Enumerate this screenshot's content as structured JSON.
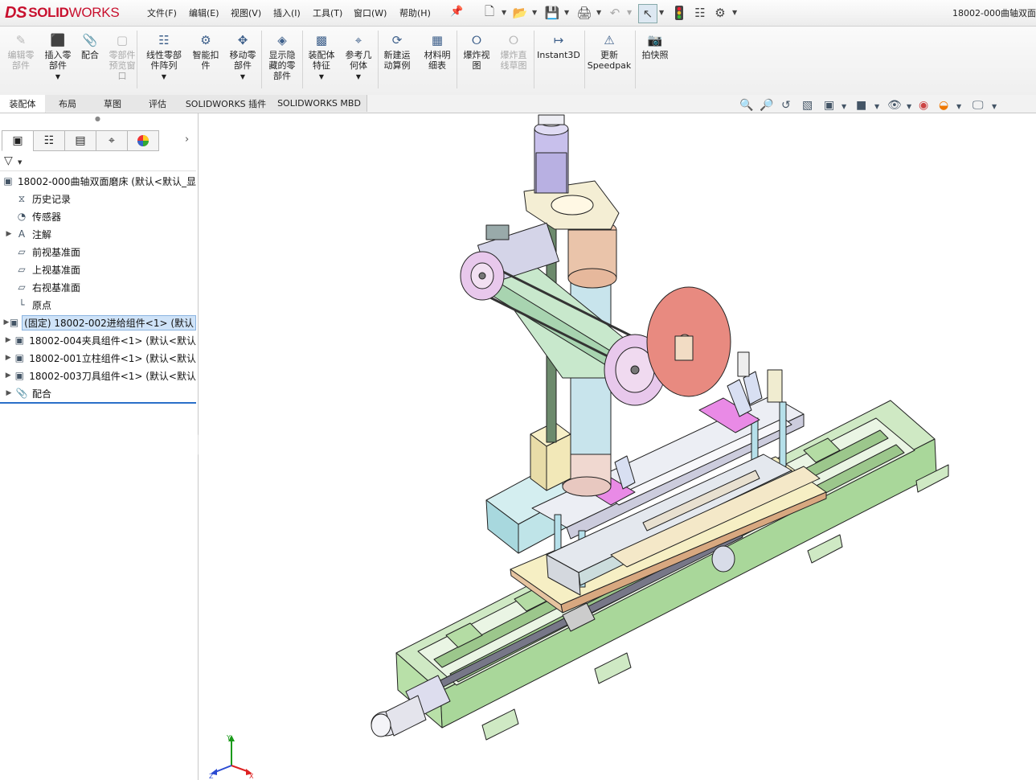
{
  "app": {
    "logo_ds": "DS",
    "logo_solid": "SOLID",
    "logo_works": "WORKS",
    "document_title": "18002-000曲轴双面"
  },
  "menu": [
    "文件(F)",
    "编辑(E)",
    "视图(V)",
    "插入(I)",
    "工具(T)",
    "窗口(W)",
    "帮助(H)"
  ],
  "commands": [
    {
      "label1": "编辑零",
      "label2": "部件",
      "label3": "",
      "disabled": true,
      "icon": "edit-component-icon"
    },
    {
      "label1": "插入零",
      "label2": "部件",
      "label3": "",
      "disabled": false,
      "icon": "insert-components-icon",
      "dropdown": true
    },
    {
      "label1": "配合",
      "label2": "",
      "label3": "",
      "disabled": false,
      "icon": "mate-icon"
    },
    {
      "label1": "零部件",
      "label2": "预览窗",
      "label3": "口",
      "disabled": true,
      "icon": "preview-window-icon"
    },
    {
      "label1": "线性零部",
      "label2": "件阵列",
      "label3": "",
      "disabled": false,
      "icon": "linear-pattern-icon",
      "dropdown": true
    },
    {
      "label1": "智能扣",
      "label2": "件",
      "label3": "",
      "disabled": false,
      "icon": "smart-fasteners-icon"
    },
    {
      "label1": "移动零",
      "label2": "部件",
      "label3": "",
      "disabled": false,
      "icon": "move-component-icon",
      "dropdown": true
    },
    {
      "label1": "显示隐",
      "label2": "藏的零",
      "label3": "部件",
      "disabled": false,
      "icon": "show-hidden-icon"
    },
    {
      "label1": "装配体",
      "label2": "特征",
      "label3": "",
      "disabled": false,
      "icon": "assembly-features-icon",
      "dropdown": true
    },
    {
      "label1": "参考几",
      "label2": "何体",
      "label3": "",
      "disabled": false,
      "icon": "reference-geometry-icon",
      "dropdown": true
    },
    {
      "label1": "新建运",
      "label2": "动算例",
      "label3": "",
      "disabled": false,
      "icon": "motion-study-icon"
    },
    {
      "label1": "材料明",
      "label2": "细表",
      "label3": "",
      "disabled": false,
      "icon": "bom-icon"
    },
    {
      "label1": "爆炸视",
      "label2": "图",
      "label3": "",
      "disabled": false,
      "icon": "exploded-view-icon"
    },
    {
      "label1": "爆炸直",
      "label2": "线草图",
      "label3": "",
      "disabled": true,
      "icon": "explode-line-icon"
    },
    {
      "label1": "Instant3D",
      "label2": "",
      "label3": "",
      "disabled": false,
      "icon": "instant3d-icon"
    },
    {
      "label1": "更新",
      "label2": "Speedpak",
      "label3": "",
      "disabled": false,
      "icon": "speedpak-icon"
    },
    {
      "label1": "拍快照",
      "label2": "",
      "label3": "",
      "disabled": false,
      "icon": "snapshot-icon"
    }
  ],
  "tabs": [
    "装配体",
    "布局",
    "草图",
    "评估",
    "SOLIDWORKS 插件",
    "SOLIDWORKS MBD"
  ],
  "tree": {
    "root": "18002-000曲轴双面磨床 (默认<默认_显",
    "items": [
      {
        "label": "历史记录",
        "expandable": false,
        "icon": "history-icon"
      },
      {
        "label": "传感器",
        "expandable": false,
        "icon": "sensor-icon"
      },
      {
        "label": "注解",
        "expandable": true,
        "icon": "annotation-icon"
      },
      {
        "label": "前视基准面",
        "expandable": false,
        "icon": "plane-icon"
      },
      {
        "label": "上视基准面",
        "expandable": false,
        "icon": "plane-icon"
      },
      {
        "label": "右视基准面",
        "expandable": false,
        "icon": "plane-icon"
      },
      {
        "label": "原点",
        "expandable": false,
        "icon": "origin-icon"
      },
      {
        "label": "(固定) 18002-002进给组件<1> (默认",
        "expandable": true,
        "icon": "subassembly-icon",
        "selected": true
      },
      {
        "label": "18002-004夹具组件<1> (默认<默认",
        "expandable": true,
        "icon": "subassembly-icon"
      },
      {
        "label": "18002-001立柱组件<1> (默认<默认",
        "expandable": true,
        "icon": "subassembly-icon"
      },
      {
        "label": "18002-003刀具组件<1> (默认<默认",
        "expandable": true,
        "icon": "subassembly-icon"
      },
      {
        "label": "配合",
        "expandable": true,
        "icon": "mates-folder-icon"
      }
    ]
  },
  "triad": {
    "x": "X",
    "y": "Y",
    "z": "Z"
  }
}
